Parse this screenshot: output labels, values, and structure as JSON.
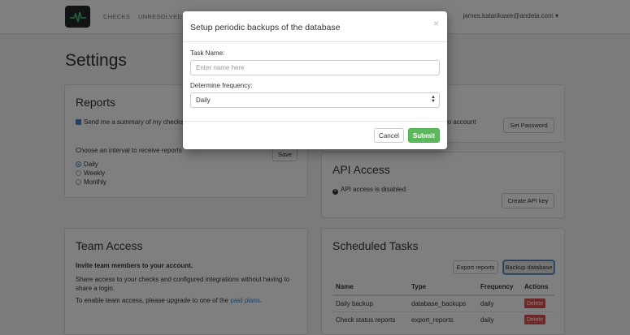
{
  "nav": {
    "links": [
      "CHECKS",
      "UNRESOLVED CH"
    ],
    "user": "james.katarikawe@andela.com ▾"
  },
  "page": {
    "title": "Settings"
  },
  "reports": {
    "title": "Reports",
    "summary_checkbox": "Send me a summary of my checks",
    "interval_label": "Choose an interval to receive reports",
    "options": [
      "Daily",
      "Weekly",
      "Monthly"
    ],
    "selected": "Daily",
    "save": "Save"
  },
  "password": {
    "text_fragment": "io account",
    "button": "Set Password"
  },
  "api": {
    "title": "API Access",
    "status": "API access is disabled.",
    "button": "Create API key"
  },
  "team": {
    "title": "Team Access",
    "invite": "Invite team members to your account.",
    "desc": "Share access to your checks and configured integrations without having to share a login.",
    "upgrade_prefix": "To enable team access, please upgrade to one of the ",
    "upgrade_link": "paid plans",
    "upgrade_suffix": "."
  },
  "tasks": {
    "title": "Scheduled Tasks",
    "export_button": "Export reports",
    "backup_button": "Backup database",
    "columns": [
      "Name",
      "Type",
      "Frequency",
      "Actions"
    ],
    "rows": [
      {
        "name": "Daily backup",
        "type": "database_backups",
        "frequency": "daily",
        "action": "Delete"
      },
      {
        "name": "Check status reports",
        "type": "export_reports",
        "frequency": "daily",
        "action": "Delete"
      }
    ]
  },
  "modal": {
    "title": "Setup periodic backups of the database",
    "close": "×",
    "task_label": "Task Name:",
    "task_placeholder": "Enter name here",
    "freq_label": "Determine frequency:",
    "freq_value": "Daily",
    "cancel": "Cancel",
    "submit": "Submit"
  },
  "colors": {
    "success": "#5cb85c",
    "danger": "#d9534f",
    "link": "#3a86d4"
  },
  "icons": [
    "pulse-logo-icon",
    "close-icon",
    "select-arrows-icon",
    "ban-icon"
  ]
}
